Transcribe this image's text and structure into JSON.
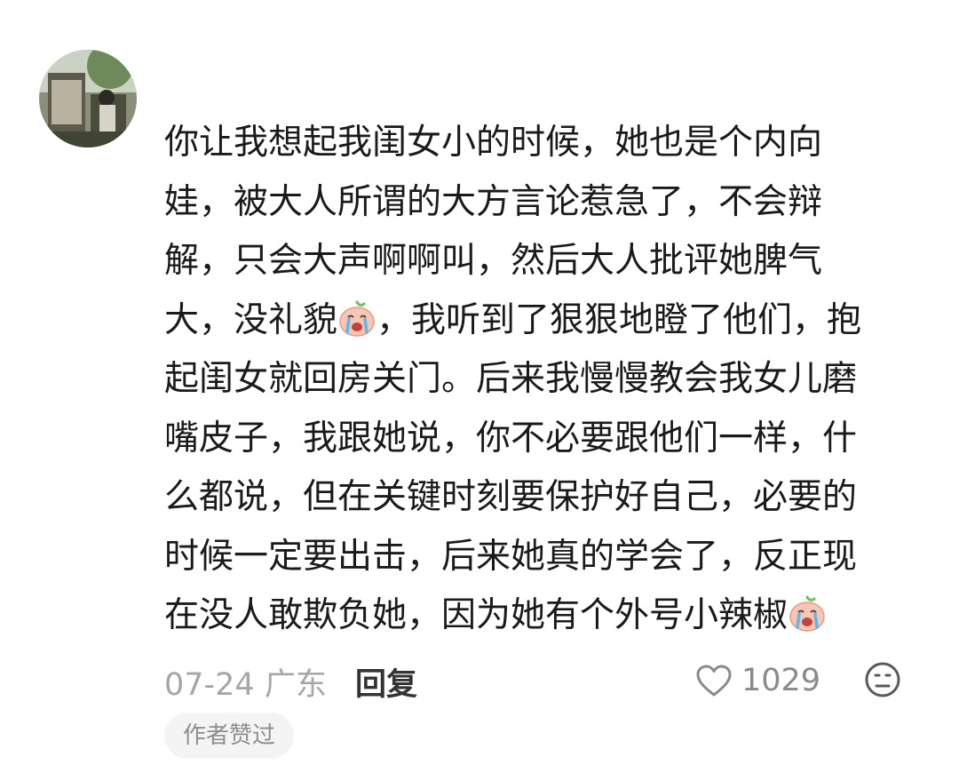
{
  "comment": {
    "lines": [
      [
        "你让我想起我闺女小的时候，她也是个内向"
      ],
      [
        "娃，被大人所谓的大方言论惹急了，不会辩"
      ],
      [
        "解，只会大声啊啊叫，然后大人批评她脾气"
      ],
      [
        "大，没礼貌",
        "，我听到了狠狠地瞪了他们，抱"
      ],
      [
        "起闺女就回房关门。后来我慢慢教会我女儿磨"
      ],
      [
        "嘴皮子，我跟她说，你不必要跟他们一样，什"
      ],
      [
        "么都说，但在关键时刻要保护好自己，必要的"
      ],
      [
        "时候一定要出击，后来她真的学会了，反正现"
      ],
      [
        "在没人敢欺负她，因为她有个外号小辣椒"
      ]
    ],
    "emoji_icon": "crying-face-sticker-icon",
    "date": "07-24 广东",
    "reply_label": "回复",
    "like_count": "1029",
    "author_badge": "作者赞过"
  },
  "colors": {
    "text": "#1a1a1a",
    "meta": "#a6a6a6",
    "badge_bg": "#f4f4f4"
  }
}
